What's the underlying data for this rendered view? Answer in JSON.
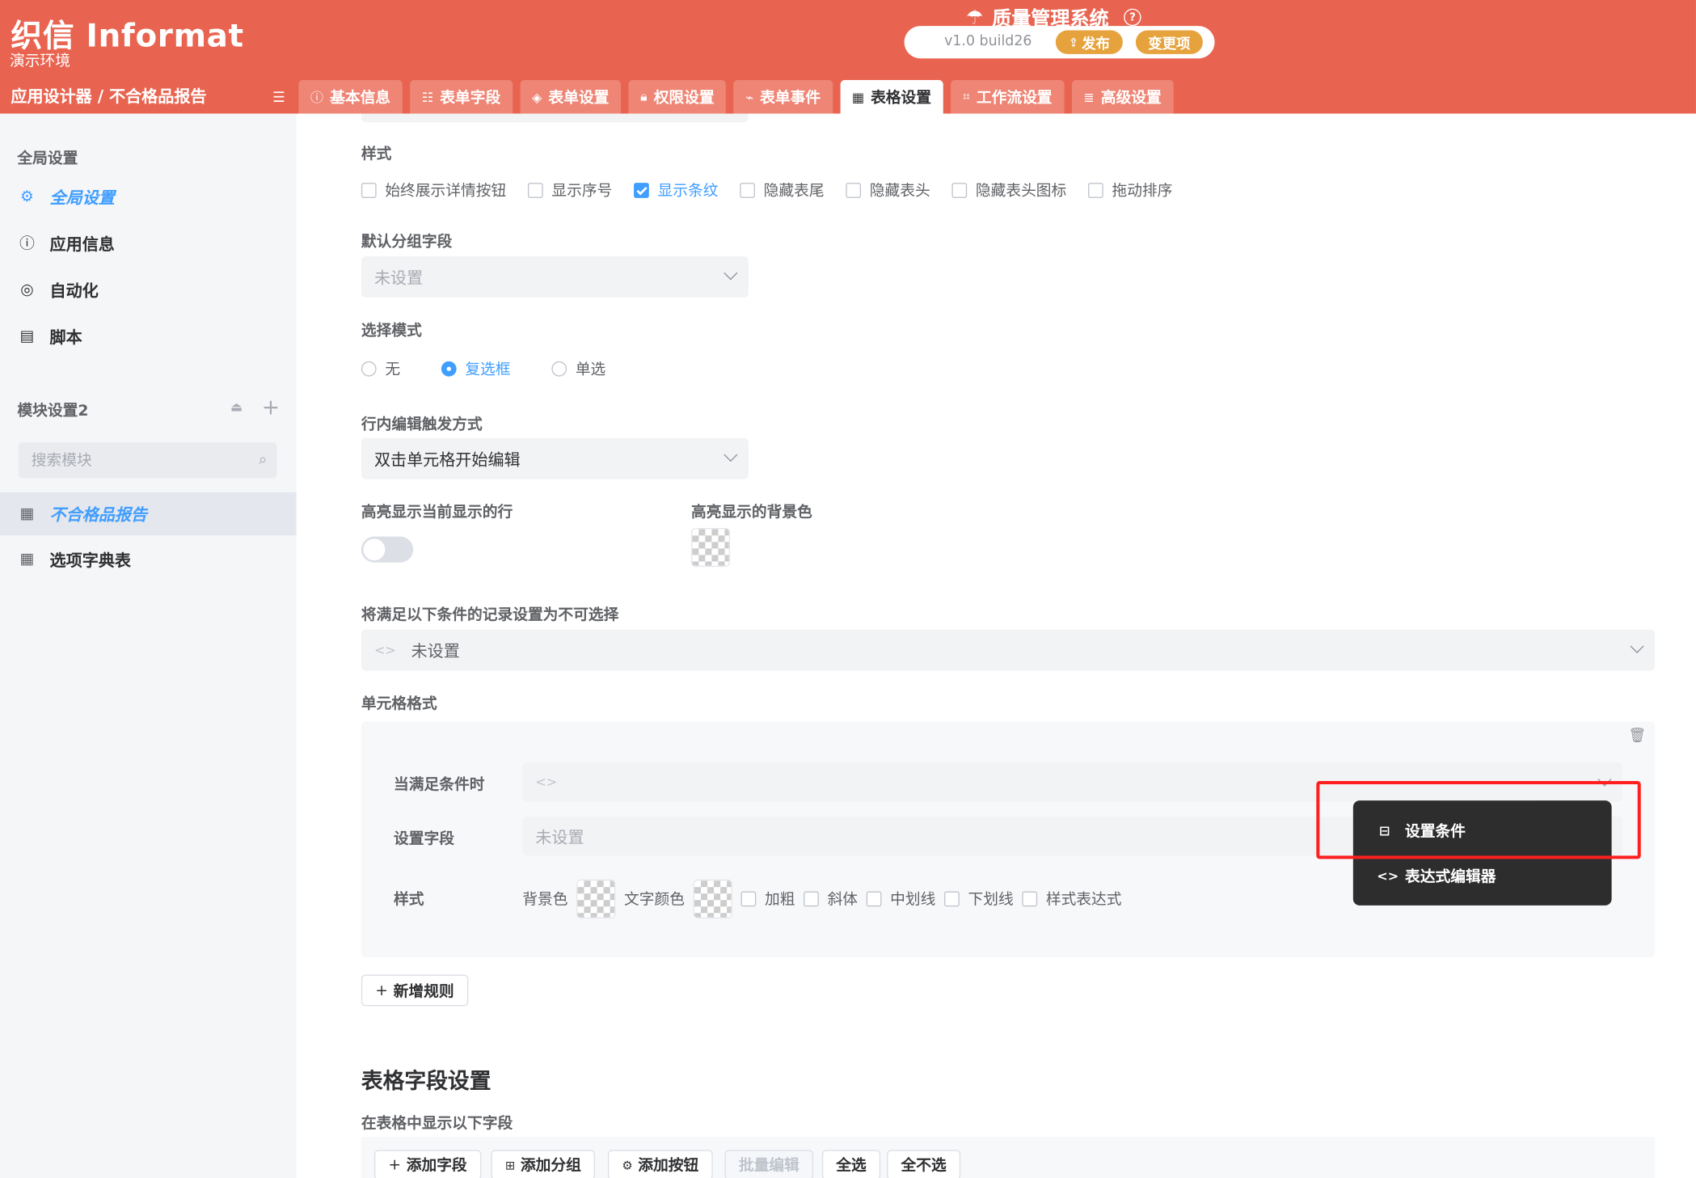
{
  "header": {
    "logo": "织信 Informat",
    "env": "演示环境",
    "system_title": "质量管理系统",
    "version": "v1.0 build26",
    "publish_label": "发布",
    "changes_label": "变更项",
    "breadcrumb": "应用设计器 / 不合格品报告",
    "brand_color": "#e96450"
  },
  "tabs": [
    {
      "label": "基本信息",
      "icon": "info-icon"
    },
    {
      "label": "表单字段",
      "icon": "form-icon"
    },
    {
      "label": "表单设置",
      "icon": "layers-icon"
    },
    {
      "label": "权限设置",
      "icon": "lock-icon"
    },
    {
      "label": "表单事件",
      "icon": "event-icon"
    },
    {
      "label": "表格设置",
      "icon": "table-icon",
      "active": true
    },
    {
      "label": "工作流设置",
      "icon": "workflow-icon"
    },
    {
      "label": "高级设置",
      "icon": "database-icon"
    }
  ],
  "sidebar": {
    "global_section": "全局设置",
    "items": [
      {
        "label": "全局设置",
        "icon": "gear-icon"
      },
      {
        "label": "应用信息",
        "icon": "info-icon"
      },
      {
        "label": "自动化",
        "icon": "automation-icon"
      },
      {
        "label": "脚本",
        "icon": "script-icon"
      }
    ],
    "module_section": "模块设置2",
    "search_placeholder": "搜索模块",
    "modules": [
      {
        "label": "不合格品报告",
        "icon": "table-icon"
      },
      {
        "label": "选项字典表",
        "icon": "table-icon"
      }
    ]
  },
  "style_section": {
    "label": "样式",
    "options": [
      {
        "label": "始终展示详情按钮",
        "checked": false
      },
      {
        "label": "显示序号",
        "checked": false
      },
      {
        "label": "显示条纹",
        "checked": true
      },
      {
        "label": "隐藏表尾",
        "checked": false
      },
      {
        "label": "隐藏表头",
        "checked": false
      },
      {
        "label": "隐藏表头图标",
        "checked": false
      },
      {
        "label": "拖动排序",
        "checked": false
      }
    ]
  },
  "group_field": {
    "label": "默认分组字段",
    "placeholder": "未设置"
  },
  "select_mode": {
    "label": "选择模式",
    "options": [
      {
        "label": "无",
        "selected": false
      },
      {
        "label": "复选框",
        "selected": true
      },
      {
        "label": "单选",
        "selected": false
      }
    ]
  },
  "inline_edit": {
    "label": "行内编辑触发方式",
    "value": "双击单元格开始编辑"
  },
  "highlight": {
    "row_label": "高亮显示当前显示的行",
    "row_on": false,
    "bg_label": "高亮显示的背景色"
  },
  "unselectable": {
    "label": "将满足以下条件的记录设置为不可选择",
    "placeholder": "未设置"
  },
  "cell_format": {
    "label": "单元格格式",
    "condition_label": "当满足条件时",
    "field_label": "设置字段",
    "field_placeholder": "未设置",
    "style_label": "样式",
    "bg_label": "背景色",
    "text_color_label": "文字颜色",
    "options": [
      {
        "label": "加粗",
        "checked": false
      },
      {
        "label": "斜体",
        "checked": false
      },
      {
        "label": "中划线",
        "checked": false
      },
      {
        "label": "下划线",
        "checked": false
      },
      {
        "label": "样式表达式",
        "checked": false
      }
    ],
    "add_rule": "新增规则"
  },
  "dropdown": {
    "items": [
      {
        "label": "设置条件",
        "icon": "condition-icon"
      },
      {
        "label": "表达式编辑器",
        "icon": "code-icon"
      }
    ]
  },
  "table_fields": {
    "title": "表格字段设置",
    "subtitle": "在表格中显示以下字段",
    "buttons": [
      {
        "label": "添加字段",
        "icon": "plus-icon",
        "disabled": false
      },
      {
        "label": "添加分组",
        "icon": "group-icon",
        "disabled": false
      },
      {
        "label": "添加按钮",
        "icon": "button-icon",
        "disabled": false
      },
      {
        "label": "批量编辑",
        "icon": "",
        "disabled": true
      },
      {
        "label": "全选",
        "icon": "",
        "disabled": false
      },
      {
        "label": "全不选",
        "icon": "",
        "disabled": false
      }
    ]
  }
}
